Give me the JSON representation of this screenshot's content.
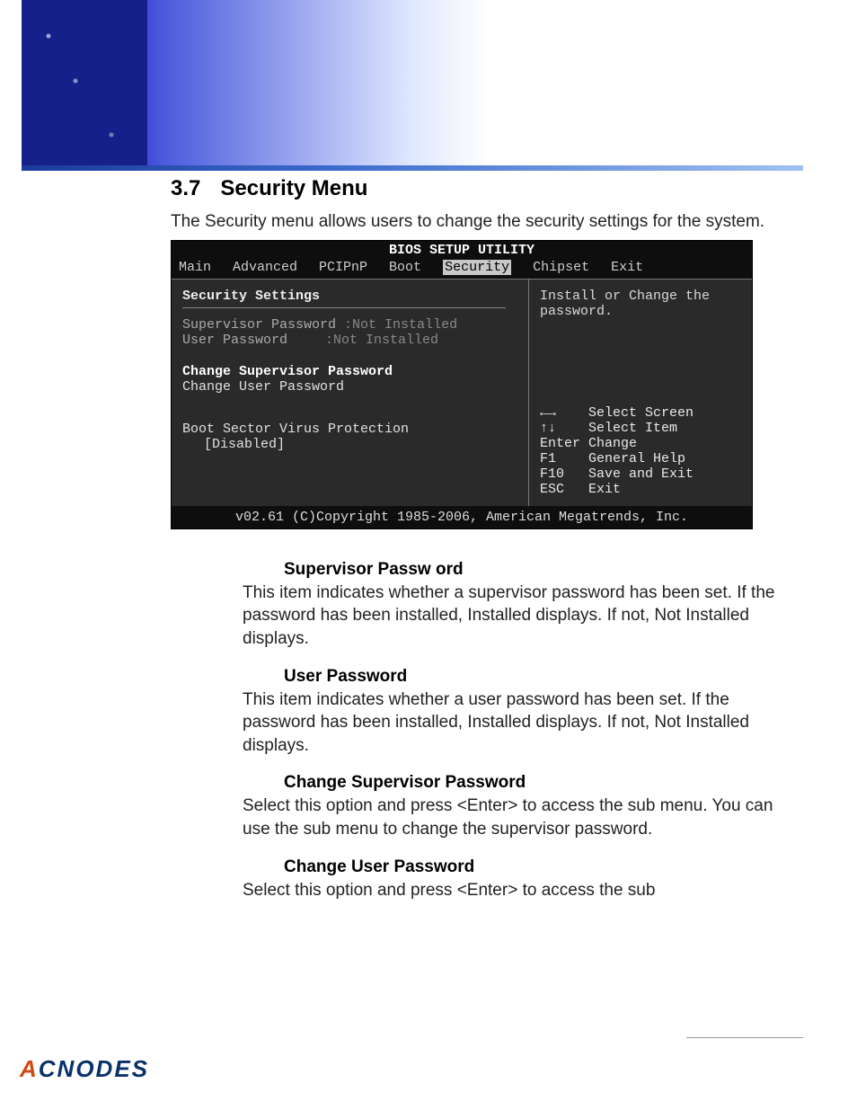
{
  "section": {
    "number": "3.7",
    "title": "Security Menu",
    "intro": "The Security menu allows users to change the security settings for the system."
  },
  "bios": {
    "title": "BIOS SETUP UTILITY",
    "tabs": [
      "Main",
      "Advanced",
      "PCIPnP",
      "Boot",
      "Security",
      "Chipset",
      "Exit"
    ],
    "active_tab": "Security",
    "left": {
      "heading": "Security Settings",
      "supervisor_label": "Supervisor Password",
      "supervisor_value": ":Not Installed",
      "user_label": "User Password",
      "user_value": ":Not Installed",
      "change_supervisor": "Change Supervisor Password",
      "change_user": "Change User Password",
      "boot_sector_label": "Boot Sector Virus Protection",
      "boot_sector_value": "[Disabled]"
    },
    "right": {
      "hint": "Install or Change the password.",
      "help": [
        {
          "key": "←→",
          "action": "Select Screen"
        },
        {
          "key": "↑↓",
          "action": "Select Item"
        },
        {
          "key": "Enter",
          "action": "Change"
        },
        {
          "key": "F1",
          "action": "General Help"
        },
        {
          "key": "F10",
          "action": "Save and Exit"
        },
        {
          "key": "ESC",
          "action": "Exit"
        }
      ]
    },
    "footer": "v02.61 (C)Copyright 1985-2006, American Megatrends, Inc."
  },
  "descriptions": [
    {
      "heading": "Supervisor Passw ord",
      "text": "This item indicates whether a supervisor password has been set. If the password has been installed, Installed displays. If not, Not Installed displays."
    },
    {
      "heading": "User Password",
      "text": "This item indicates whether a user password has been set. If the password has been installed, Installed displays. If not,  Not Installed displays."
    },
    {
      "heading": "Change Supervisor Password",
      "text": "Select this option and press <Enter> to access the sub menu. You can use the sub menu to change the supervisor password."
    },
    {
      "heading": "Change User Password",
      "text": "Select this option and press <Enter> to access the sub"
    }
  ],
  "logo": {
    "a": "A",
    "rest": "CNODES"
  }
}
